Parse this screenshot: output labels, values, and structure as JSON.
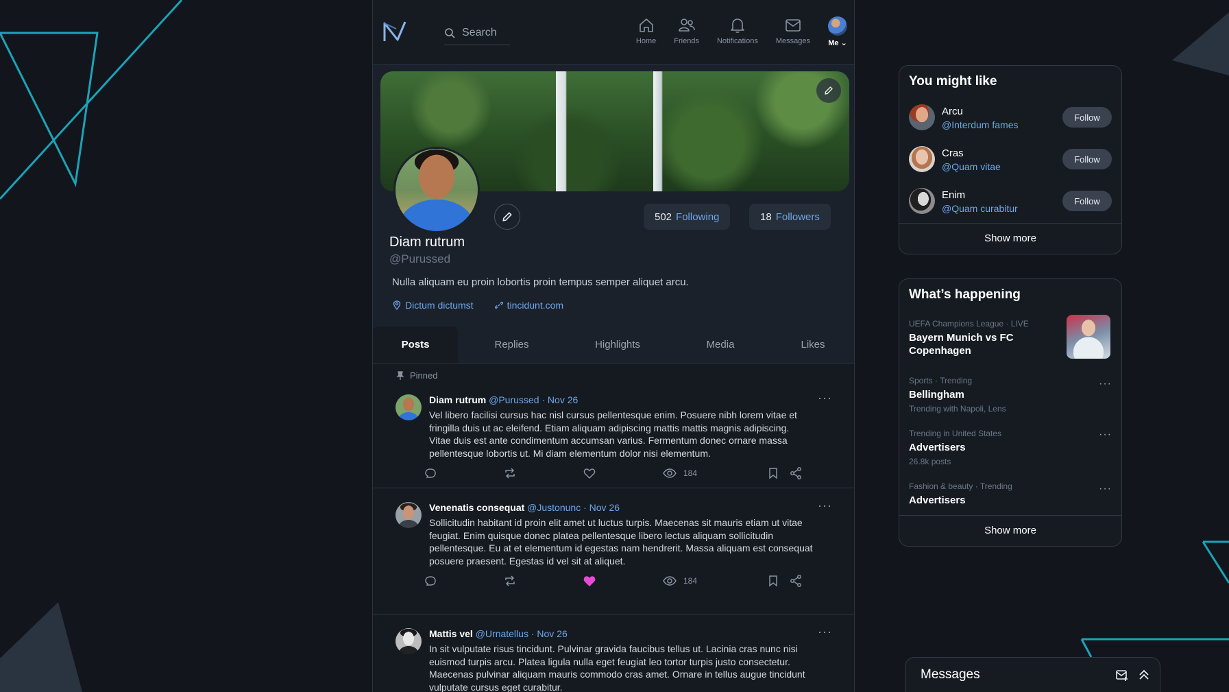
{
  "nav": {
    "search_placeholder": "Search",
    "items": [
      {
        "label": "Home",
        "icon": "home-icon"
      },
      {
        "label": "Friends",
        "icon": "friends-icon"
      },
      {
        "label": "Notifications",
        "icon": "bell-icon"
      },
      {
        "label": "Messages",
        "icon": "mail-icon"
      }
    ],
    "me_label": "Me"
  },
  "profile": {
    "name": "Diam rutrum",
    "handle": "@Purussed",
    "bio": "Nulla aliquam eu proin lobortis proin tempus semper aliquet arcu.",
    "location": "Dictum dictumst",
    "website": "tincidunt.com",
    "following_count": "502",
    "following_label": "Following",
    "followers_count": "18",
    "followers_label": "Followers"
  },
  "tabs": [
    "Posts",
    "Replies",
    "Highlights",
    "Media",
    "Likes"
  ],
  "feed": {
    "pinned_label": "Pinned",
    "posts": [
      {
        "name": "Diam rutrum",
        "handle": "@Purussed",
        "date": "· Nov 26",
        "text": "Vel libero facilisi cursus hac nisl cursus pellentesque enim. Posuere nibh lorem vitae et fringilla duis ut ac eleifend. Etiam aliquam adipiscing mattis mattis magnis adipiscing. Vitae duis est ante condimentum accumsan varius. Fermentum donec ornare massa pellentesque lobortis ut. Mi diam elementum dolor nisi elementum.",
        "views": "184",
        "liked": false
      },
      {
        "name": "Venenatis consequat",
        "handle": "@Justonunc",
        "date": "· Nov 26",
        "text": "Sollicitudin habitant id proin elit amet ut luctus turpis. Maecenas sit mauris etiam ut vitae feugiat. Enim quisque donec platea pellentesque libero lectus aliquam sollicitudin pellentesque. Eu at et elementum id egestas nam hendrerit. Massa aliquam est consequat posuere praesent. Egestas id vel sit at aliquet.",
        "views": "184",
        "liked": true
      },
      {
        "name": "Mattis vel",
        "handle": "@Urnatellus",
        "date": "· Nov 26",
        "text": "In sit vulputate risus tincidunt. Pulvinar gravida faucibus tellus ut. Lacinia cras nunc nisi euismod turpis arcu. Platea ligula nulla eget feugiat leo tortor turpis justo consectetur. Maecenas pulvinar aliquam mauris commodo cras amet. Ornare in tellus augue tincidunt vulputate cursus eget curabitur."
      }
    ]
  },
  "suggestions": {
    "title": "You might like",
    "follow_label": "Follow",
    "items": [
      {
        "name": "Arcu",
        "handle": "@Interdum fames"
      },
      {
        "name": "Cras",
        "handle": "@Quam vitae"
      },
      {
        "name": "Enim",
        "handle": "@Quam curabitur"
      }
    ],
    "show_more": "Show more"
  },
  "happening": {
    "title": "What’s happening",
    "items": [
      {
        "meta": "UEFA Champions League · LIVE",
        "title": "Bayern Munich vs FC Copenhagen",
        "sub": ""
      },
      {
        "meta": "Sports · Trending",
        "title": "Bellingham",
        "sub": "Trending with Napoli, Lens"
      },
      {
        "meta": "Trending in United States",
        "title": "Advertisers",
        "sub": "26.8k posts"
      },
      {
        "meta": "Fashion & beauty · Trending",
        "title": "Advertisers",
        "sub": ""
      }
    ],
    "show_more": "Show more"
  },
  "messages_bar": {
    "title": "Messages"
  },
  "colors": {
    "accent": "#6ea7e8",
    "like": "#e84ad8",
    "teal_line": "#1ba3b8",
    "background": "#12161c"
  }
}
